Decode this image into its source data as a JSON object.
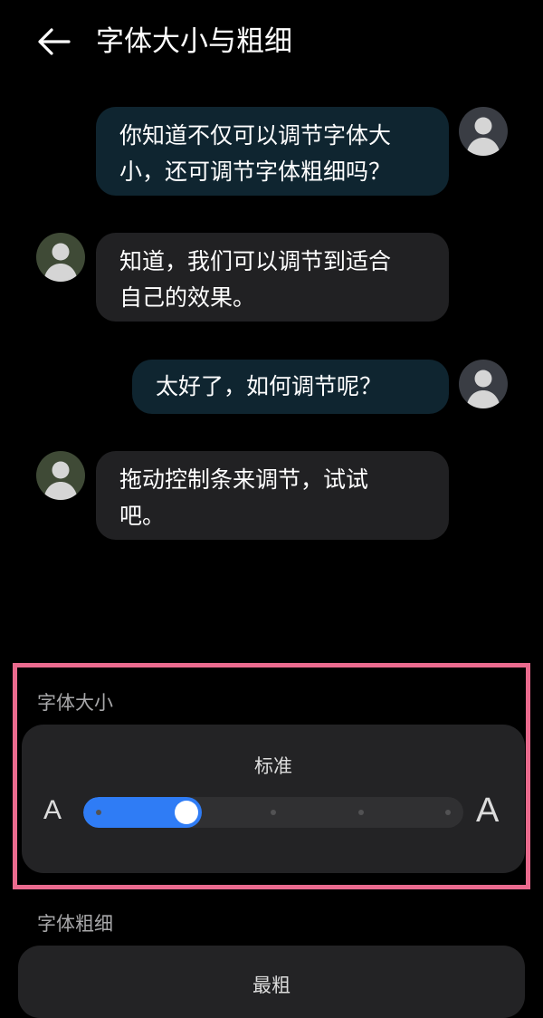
{
  "header": {
    "title": "字体大小与粗细",
    "back_icon": "arrow-left-icon"
  },
  "conversation": [
    {
      "side": "sent",
      "lines": [
        "你知道不仅可以调节字体大",
        "小，还可调节字体粗细吗？"
      ]
    },
    {
      "side": "received",
      "lines": [
        "知道，我们可以调节到适合",
        "自己的效果。"
      ]
    },
    {
      "side": "sent",
      "lines": [
        "太好了，如何调节呢？"
      ]
    },
    {
      "side": "received",
      "lines": [
        "拖动控制条来调节，试试",
        "吧。"
      ]
    }
  ],
  "avatar_colors": {
    "sent": "#3a3d44",
    "received": "#3f4a36"
  },
  "font_size": {
    "label": "字体大小",
    "level_label": "标准",
    "small_glyph": "A",
    "large_glyph": "A",
    "value": 0.25,
    "steps": 5,
    "accent": "#2f7cf5"
  },
  "font_weight": {
    "label": "字体粗细",
    "level_label_partial": "最粗"
  },
  "highlight_color": "#ea6a8e"
}
